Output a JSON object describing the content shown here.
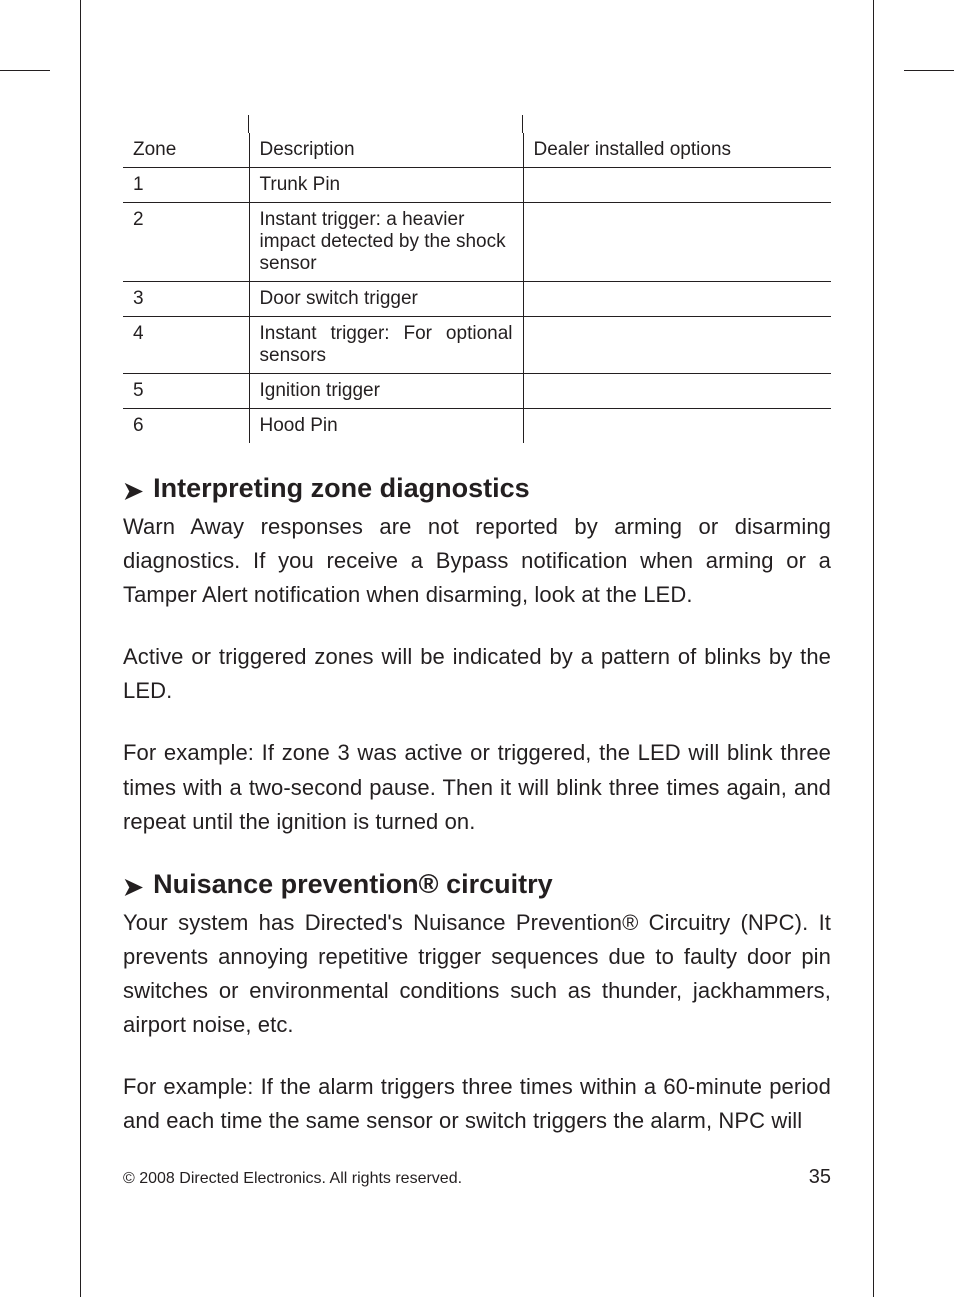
{
  "table": {
    "headers": {
      "zone": "Zone",
      "description": "Description",
      "options": "Dealer installed options"
    },
    "rows": [
      {
        "zone": "1",
        "description": "Trunk Pin",
        "options": ""
      },
      {
        "zone": "2",
        "description": "Instant trigger: a heavier impact detected by the shock sensor",
        "options": ""
      },
      {
        "zone": "3",
        "description": "Door switch trigger",
        "options": ""
      },
      {
        "zone": "4",
        "description": "Instant trigger: For optional sensors",
        "options": ""
      },
      {
        "zone": "5",
        "description": "Ignition trigger",
        "options": ""
      },
      {
        "zone": "6",
        "description": "Hood Pin",
        "options": ""
      }
    ]
  },
  "sections": {
    "interpreting": {
      "title": "Interpreting zone diagnostics",
      "p1": "Warn Away responses are not reported by arming or disarming diagnostics. If you receive a Bypass notification when arming or a Tamper Alert notification when disarming, look at the LED.",
      "p2": "Active or triggered zones will be indicated by a pattern of blinks by the LED.",
      "example_lead": "For example:",
      "example_body": " If zone 3 was active or triggered, the LED will blink three times with a two-second pause. Then it will blink three times again, and repeat until the ignition is turned on."
    },
    "nuisance": {
      "title": "Nuisance prevention® circuitry",
      "p1": "Your system has Directed's Nuisance Prevention® Circuitry (NPC). It prevents annoying repetitive trigger sequences due to faulty door pin switches or environmental conditions such as thunder, jackhammers, airport noise, etc.",
      "example_lead": "For example:",
      "example_body": " If the alarm triggers three times within a 60-minute period and each time the same sensor or switch triggers the alarm, NPC will"
    }
  },
  "footer": {
    "copyright": "© 2008 Directed Electronics. All rights reserved.",
    "page": "35"
  }
}
